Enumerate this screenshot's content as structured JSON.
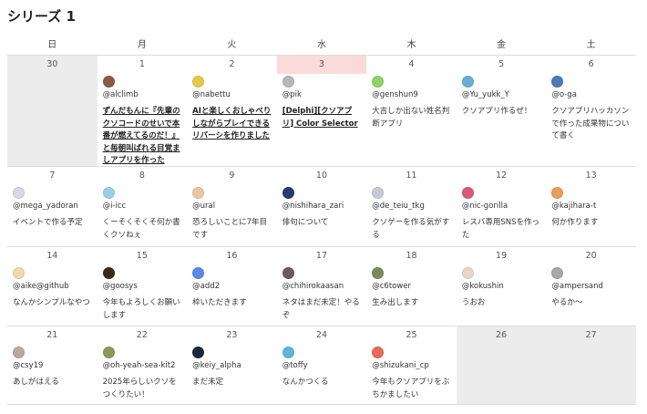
{
  "title": "シリーズ 1",
  "weekdays": [
    "日",
    "月",
    "火",
    "水",
    "木",
    "金",
    "土"
  ],
  "weeks": [
    [
      {
        "day": "30",
        "gray": true
      },
      {
        "day": "1",
        "user": "@alclimb",
        "post": "ずんだもんに『先輩のクソコードのせいで本番が燃えてるのだ！』と毎朝叫ばれる目覚ましアプリを作った",
        "link": true,
        "avatar_color": "#8a5a44"
      },
      {
        "day": "2",
        "user": "@nabettu",
        "post": "AIと楽しくおしゃべりしながらプレイできるリバーシを作りました",
        "link": true,
        "avatar_color": "#e6c84a"
      },
      {
        "day": "3",
        "today": true,
        "user": "@pik",
        "post": "[Delphi][クソアプリ] Color Selector",
        "link": true,
        "avatar_color": "#b8b8b8"
      },
      {
        "day": "4",
        "user": "@genshun9",
        "post": "大吉しか出ない姓名判断アプリ",
        "avatar_color": "#8cd46a"
      },
      {
        "day": "5",
        "user": "@Yu_yukk_Y",
        "post": "クソアプリ作るぜ！",
        "avatar_color": "#6aaed6"
      },
      {
        "day": "6",
        "user": "@o-ga",
        "post": "クソアプリハッカソンで作った成果物について書く",
        "avatar_color": "#4a7ab8"
      }
    ],
    [
      {
        "day": "7",
        "user": "@mega_yadoran",
        "post": "イベントで作る予定",
        "avatar_color": "#d8d8e6"
      },
      {
        "day": "8",
        "user": "@i-icc",
        "post": "くーそくそくそ何か書くクソねぇ",
        "avatar_color": "#9ad0e6"
      },
      {
        "day": "9",
        "user": "@ural",
        "post": "恐ろしいことに7年目です",
        "avatar_color": "#e6c8a0"
      },
      {
        "day": "10",
        "user": "@nishihara_zari",
        "post": "俳句について",
        "avatar_color": "#2a3a6a"
      },
      {
        "day": "11",
        "user": "@de_teiu_tkg",
        "post": "クソゲーを作る気がする",
        "avatar_color": "#c8c8d8"
      },
      {
        "day": "12",
        "user": "@nic-gorilla",
        "post": "レスバ専用SNSを作った",
        "avatar_color": "#d85a7a"
      },
      {
        "day": "13",
        "user": "@kajihara-t",
        "post": "何か作ります",
        "avatar_color": "#e6a05a"
      }
    ],
    [
      {
        "day": "14",
        "user": "@aike@github",
        "post": "なんかシンプルなやつ",
        "avatar_color": "#f0d8b0"
      },
      {
        "day": "15",
        "user": "@goosys",
        "post": "今年もよろしくお願いします",
        "avatar_color": "#3a2a1a"
      },
      {
        "day": "16",
        "user": "@add2",
        "post": "枠いただきます",
        "avatar_color": "#5a8ae6"
      },
      {
        "day": "17",
        "user": "@chihirokaasan",
        "post": "ネタはまだ未定！やるぞ",
        "avatar_color": "#6a5a5a"
      },
      {
        "day": "18",
        "user": "@c6tower",
        "post": "生み出します",
        "avatar_color": "#7a8a5a"
      },
      {
        "day": "19",
        "user": "@kokushin",
        "post": "うおお",
        "avatar_color": "#e6d8c8"
      },
      {
        "day": "20",
        "user": "@ampersand",
        "post": "やるか〜",
        "avatar_color": "#a8a8a8"
      }
    ],
    [
      {
        "day": "21",
        "user": "@csy19",
        "post": "あしがはえる",
        "avatar_color": "#b8a8a0"
      },
      {
        "day": "22",
        "user": "@oh-yeah-sea-kit2",
        "post": "2025年らしいクソをつくりたい！",
        "avatar_color": "#8a9a5a"
      },
      {
        "day": "23",
        "user": "@keiy_alpha",
        "post": "まだ未定",
        "avatar_color": "#1a2a3a"
      },
      {
        "day": "24",
        "user": "@toffy",
        "post": "なんかつくる",
        "avatar_color": "#5ab8d8"
      },
      {
        "day": "25",
        "user": "@shizukani_cp",
        "post": "今年もクソアプリをぶちかましたい",
        "avatar_color": "#e66a5a"
      },
      {
        "day": "26",
        "gray": true
      },
      {
        "day": "27",
        "gray": true
      }
    ]
  ]
}
